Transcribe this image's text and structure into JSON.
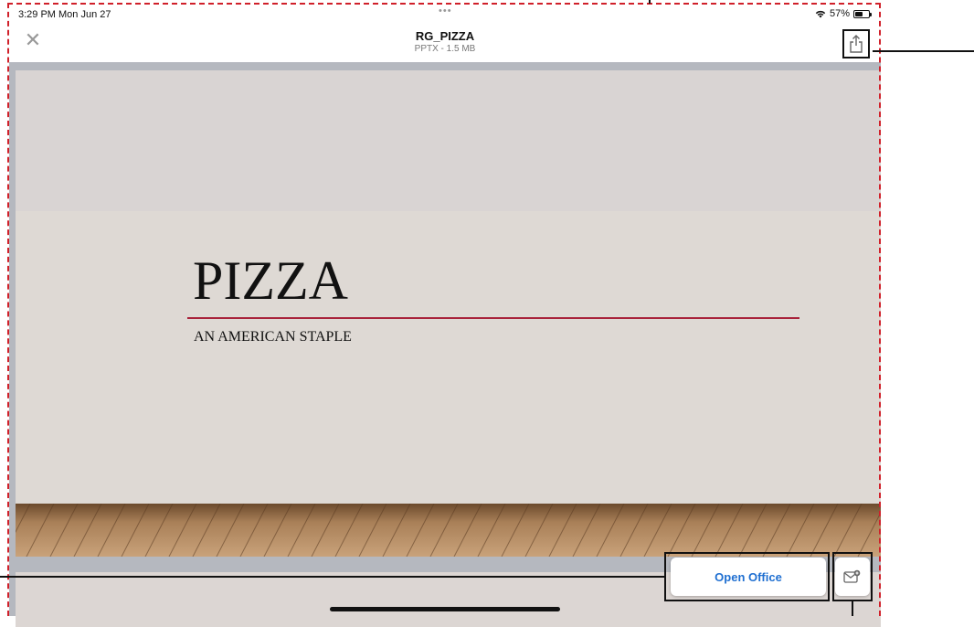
{
  "status_bar": {
    "time": "3:29 PM  Mon Jun 27",
    "dots": "•••",
    "battery_text": "57%",
    "battery_level": 0.57
  },
  "header": {
    "title": "RG_PIZZA",
    "subtitle": "PPTX - 1.5 MB",
    "close_glyph": "✕"
  },
  "slide": {
    "title": "PIZZA",
    "subtitle": "AN AMERICAN STAPLE",
    "accent_color": "#a8223a"
  },
  "actions": {
    "open_office_label": "Open Office"
  },
  "icons": {
    "share": "share-icon",
    "mail": "mail-attachment-icon",
    "wifi": "wifi-icon",
    "battery": "battery-icon",
    "close": "close-icon"
  }
}
